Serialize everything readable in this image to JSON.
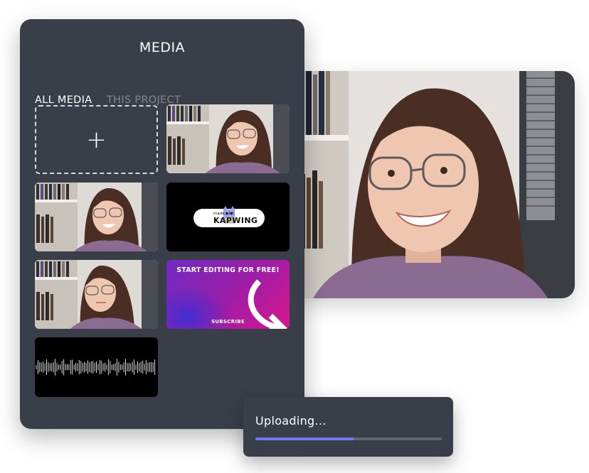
{
  "panel": {
    "title": "MEDIA",
    "tabs": [
      {
        "label": "ALL MEDIA",
        "active": true
      },
      {
        "label": "THIS PROJECT",
        "active": false
      }
    ]
  },
  "tiles": {
    "add_icon": "plus-icon",
    "kapwing": {
      "small_text": "made with",
      "brand": "KAPWING"
    },
    "promo": {
      "title": "START EDITING FOR FREE!",
      "subtitle": "SUBSCRIBE"
    }
  },
  "upload": {
    "status": "Uploading...",
    "progress": 0.53
  },
  "colors": {
    "panel_bg": "#3a3e49",
    "progress_fill": "#6e78f0",
    "progress_track": "#60656f",
    "tab_inactive": "#808691"
  }
}
